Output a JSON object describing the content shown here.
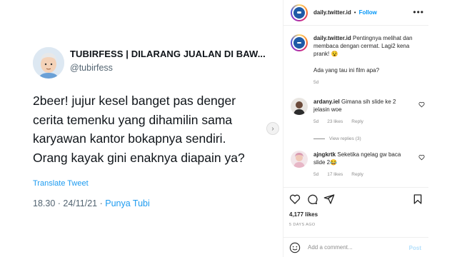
{
  "tweet": {
    "display_name": "TUBIRFESS | DILARANG JUALAN DI BAW...",
    "handle": "@tubirfess",
    "avatar_label": "Sinner",
    "lines": [
      "2beer! jujur kesel banget pas denger",
      "cerita temenku yang dihamilin sama",
      "karyawan kantor bokapnya sendiri.",
      "Orang kayak gini enaknya diapain ya?"
    ],
    "translate": "Translate Tweet",
    "time_date": "18.30 · 24/11/21 · ",
    "source": "Punya Tubi"
  },
  "post": {
    "username": "daily.twitter.id",
    "separator": "•",
    "follow": "Follow",
    "caption_user": "daily.twitter.id",
    "caption_text": "Pentingnya melihat dan membaca dengan cermat. Lagi2 kena prank! 😵",
    "caption_question": "Ada yang tau ini film apa?",
    "caption_time": "5d",
    "comments": [
      {
        "user": "ardany.iel",
        "text": "Gimana sih slide ke 2 jelasin woe",
        "time": "5d",
        "likes": "23 likes",
        "reply": "Reply",
        "view_replies": "View replies (3)"
      },
      {
        "user": "ajngkrtk",
        "text": "Seketika ngelag gw baca slide 2😂",
        "time": "5d",
        "likes": "17 likes",
        "reply": "Reply"
      }
    ],
    "likes": "4,177 likes",
    "posted": "5 DAYS AGO",
    "comment_placeholder": "Add a comment...",
    "post_button": "Post"
  },
  "colors": {
    "ig_blue": "#0095f6",
    "twitter_blue": "#1d9bf0",
    "muted": "#8e8e8e"
  },
  "icons": [
    "more-icon",
    "heart-icon",
    "comment-icon",
    "share-icon",
    "bookmark-icon",
    "emoji-icon",
    "chevron-right-icon"
  ]
}
